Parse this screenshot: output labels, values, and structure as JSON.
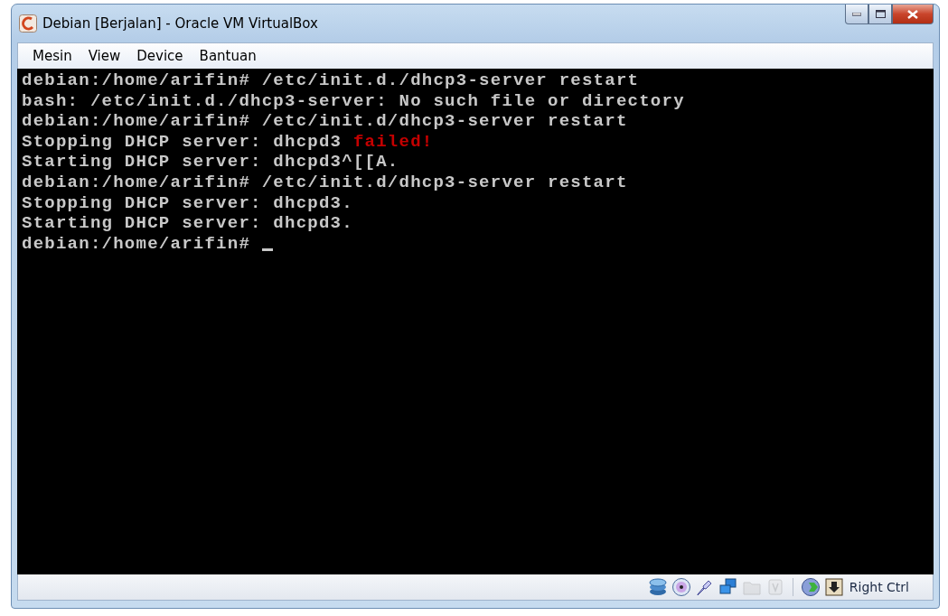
{
  "window": {
    "title": "Debian [Berjalan] - Oracle VM VirtualBox"
  },
  "menu": [
    "Mesin",
    "View",
    "Device",
    "Bantuan"
  ],
  "terminal": {
    "lines": [
      [
        {
          "text": "debian:/home/arifin# /etc/init.d./dhcp3-server restart"
        }
      ],
      [
        {
          "text": "bash: /etc/init.d./dhcp3-server: No such file or directory"
        }
      ],
      [
        {
          "text": "debian:/home/arifin# /etc/init.d/dhcp3-server restart"
        }
      ],
      [
        {
          "text": "Stopping DHCP server: dhcpd3 "
        },
        {
          "text": "failed!",
          "color": "#c40000"
        }
      ],
      [
        {
          "text": "Starting DHCP server: dhcpd3^[[A."
        }
      ],
      [
        {
          "text": "debian:/home/arifin# /etc/init.d/dhcp3-server restart"
        }
      ],
      [
        {
          "text": "Stopping DHCP server: dhcpd3."
        }
      ],
      [
        {
          "text": "Starting DHCP server: dhcpd3."
        }
      ],
      [
        {
          "text": "debian:/home/arifin# "
        }
      ]
    ],
    "cursor": true
  },
  "status_bar": {
    "icons": [
      {
        "kind": "disk",
        "disabled": false
      },
      {
        "kind": "cd",
        "disabled": false
      },
      {
        "kind": "usb",
        "disabled": false
      },
      {
        "kind": "network",
        "disabled": false
      },
      {
        "kind": "folder",
        "disabled": true
      },
      {
        "kind": "chip",
        "disabled": true
      },
      {
        "kind": "globe",
        "disabled": false
      },
      {
        "kind": "capture",
        "disabled": false
      }
    ],
    "host_key": "Right Ctrl"
  }
}
